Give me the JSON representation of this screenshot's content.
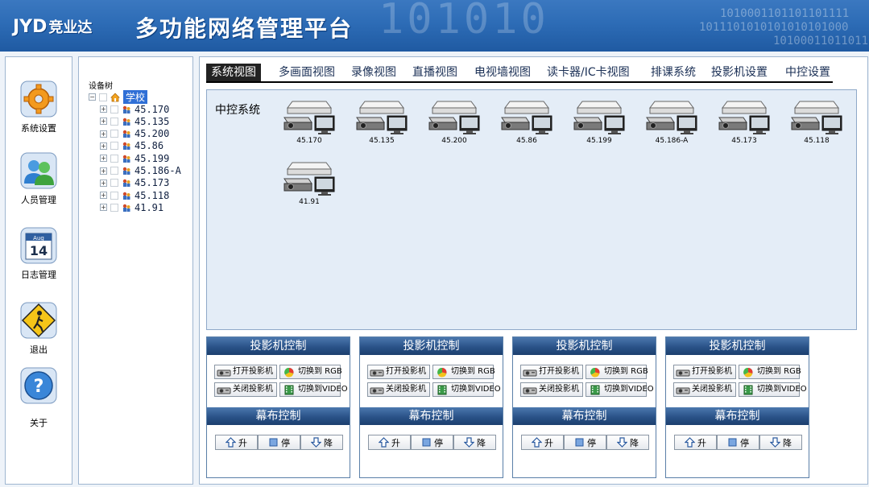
{
  "header": {
    "logo_brand": "JYD",
    "logo_cn": "竞业达",
    "title": "多功能网络管理平台",
    "binary_big": "101010",
    "binary_lines": [
      "1010001101101101111",
      "1011101010101010101000",
      "101000110110110"
    ]
  },
  "nav": [
    {
      "label": "系统设置",
      "icon": "gear-icon"
    },
    {
      "label": "人员管理",
      "icon": "users-icon"
    },
    {
      "label": "日志管理",
      "icon": "calendar-icon"
    },
    {
      "label": "退出",
      "icon": "exit-sign-icon"
    },
    {
      "label": "关于",
      "icon": "help-icon"
    }
  ],
  "tree": {
    "title": "设备树",
    "root": "学校",
    "nodes": [
      "45.170",
      "45.135",
      "45.200",
      "45.86",
      "45.199",
      "45.186-A",
      "45.173",
      "45.118",
      "41.91"
    ]
  },
  "tabs": [
    "系统视图",
    "多画面视图",
    "录像视图",
    "直播视图",
    "电视墙视图",
    "读卡器/IC卡视图",
    "排课系统",
    "投影机设置",
    "中控设置"
  ],
  "view": {
    "title": "中控系统",
    "devices": [
      "45.170",
      "45.135",
      "45.200",
      "45.86",
      "45.199",
      "45.186-A",
      "45.173",
      "45.118",
      "41.91"
    ]
  },
  "control": {
    "projector_title": "投影机控制",
    "open_projector": "打开投影机",
    "close_projector": "关闭投影机",
    "switch_rgb": "切换到 RGB",
    "switch_video": "切换到VIDEO",
    "screen_title": "幕布控制",
    "screen_up": "升",
    "screen_stop": "停",
    "screen_down": "降"
  },
  "colors": {
    "header_blue": "#2d6cb6",
    "panel_header": "#2a5288",
    "tree_selected": "#2f6fd6",
    "view_bg": "#e4edf7"
  }
}
